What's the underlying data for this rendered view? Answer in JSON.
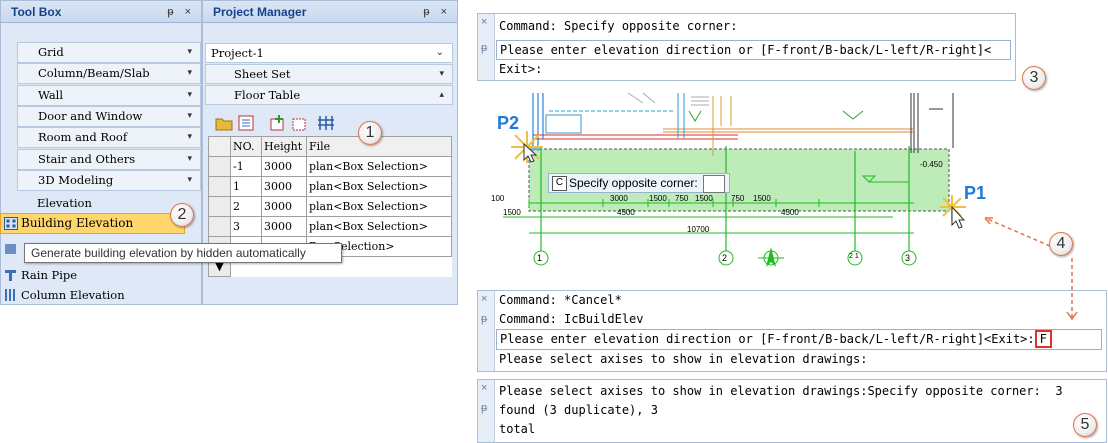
{
  "toolbox": {
    "title": "Tool Box",
    "head_buttons": "ر ×",
    "items": [
      {
        "label": "Grid"
      },
      {
        "label": "Column/Beam/Slab"
      },
      {
        "label": "Wall"
      },
      {
        "label": "Door and Window"
      },
      {
        "label": "Room and Roof"
      },
      {
        "label": "Stair and Others"
      },
      {
        "label": "3D Modeling"
      }
    ],
    "elevation_label": "Elevation",
    "building_elevation": "Building Elevation",
    "rain_pipe": "Rain Pipe",
    "column_elevation": "Column Elevation",
    "tooltip": "Generate building elevation by hidden automatically"
  },
  "project_manager": {
    "title": "Project Manager",
    "project": "Project-1",
    "sheet_set": "Sheet Set",
    "floor_table": "Floor Table",
    "columns": [
      "NO.",
      "Height",
      "File"
    ],
    "rows": [
      {
        "no": "-1",
        "height": "3000",
        "file": "plan<Box Selection>"
      },
      {
        "no": "1",
        "height": "3000",
        "file": "plan<Box Selection>"
      },
      {
        "no": "2",
        "height": "3000",
        "file": "plan<Box Selection>"
      },
      {
        "no": "3",
        "height": "3000",
        "file": "plan<Box Selection>"
      },
      {
        "no": "",
        "height": "",
        "file": "Box Selection>"
      }
    ]
  },
  "cmd_top": {
    "lines": [
      "Command: Specify opposite corner:",
      "Please enter elevation direction or [F-front/B-back/L-left/R-right]<",
      "Exit>:"
    ]
  },
  "cad": {
    "p1": "P1",
    "p2": "P2",
    "prompt": "Specify opposite corner:",
    "prompt_icon": "C",
    "dims_top": [
      "3000",
      "1500",
      "750",
      "1500",
      "750",
      "1500"
    ],
    "dims_mid": [
      "1500",
      "4500",
      "4500"
    ],
    "dim_total": "10700",
    "level": "-0.450",
    "axes": [
      "1",
      "2",
      "2 1",
      "3"
    ],
    "side_dims": [
      "1500",
      "100"
    ]
  },
  "cmd_mid": {
    "lines": [
      "Command: *Cancel*",
      "Command: IcBuildElev",
      "Please enter elevation direction or [F-front/B-back/L-left/R-right]<Exit>:",
      "Please select axises to show in elevation drawings:"
    ],
    "input_value": "F"
  },
  "cmd_bot": {
    "lines": [
      "Please select axises to show in elevation drawings:Specify opposite corner:",
      "found (3 duplicate), 3",
      "total"
    ],
    "overflow": "3"
  },
  "badges": [
    "1",
    "2",
    "3",
    "4",
    "5"
  ],
  "colors": {
    "accent": "#15428b",
    "highlight": "#ffd66b",
    "selection": "#a8e6a0",
    "callout": "#e0744a"
  }
}
